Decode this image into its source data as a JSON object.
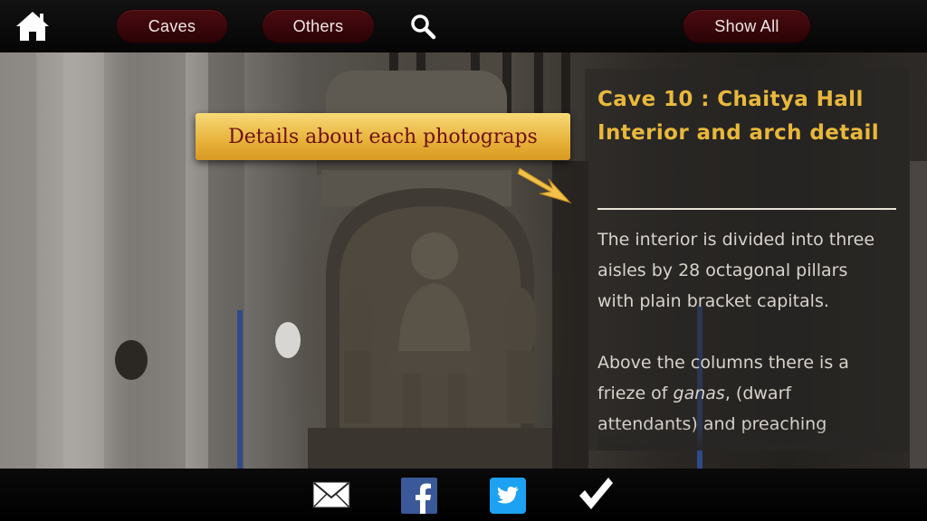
{
  "nav": {
    "caves_label": "Caves",
    "others_label": "Others",
    "show_all_label": "Show All"
  },
  "callout": {
    "text": "Details about each photograps"
  },
  "details": {
    "title": "Cave 10 : Chaitya Hall Interior and arch detail",
    "paragraph1": "The interior is divided into three aisles by 28 octagonal pillars with plain bracket capitals.",
    "paragraph2_before": "Above the columns there is a frieze of ",
    "paragraph2_em": "ganas",
    "paragraph2_after": ", (dwarf attendants) and preaching"
  },
  "icons": {
    "home": "home-icon",
    "search": "search-icon",
    "mail": "mail-icon",
    "facebook": "facebook-icon",
    "twitter": "twitter-icon",
    "check": "checkmark-icon"
  },
  "colors": {
    "pill_bg": "#3a060a",
    "title_gold": "#e8b83c",
    "callout_text": "#6e0f10",
    "facebook_blue": "#3b5998",
    "twitter_blue": "#1da1f2"
  }
}
